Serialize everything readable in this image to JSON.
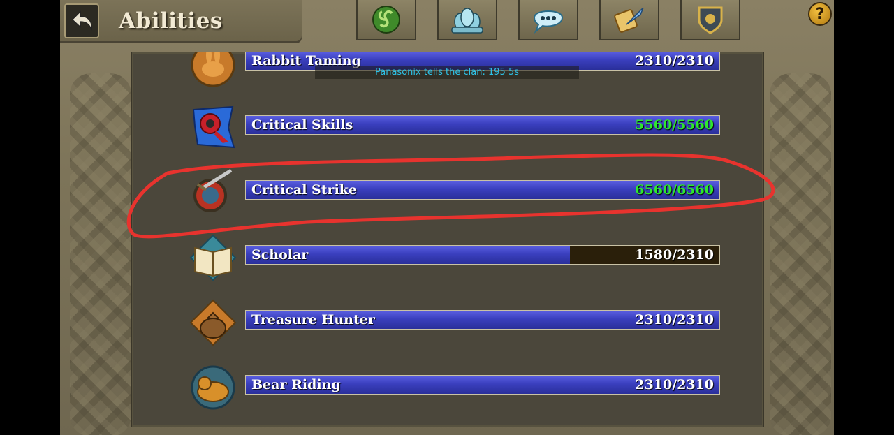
{
  "header": {
    "title": "Abilities"
  },
  "top_buttons": [
    {
      "name": "skills-tab-button",
      "icon": "triskelion-icon"
    },
    {
      "name": "clan-tab-button",
      "icon": "group-icon"
    },
    {
      "name": "chat-tab-button",
      "icon": "speech-bubble-icon"
    },
    {
      "name": "quests-tab-button",
      "icon": "scroll-quill-icon"
    },
    {
      "name": "guild-tab-button",
      "icon": "shield-crest-icon"
    }
  ],
  "help": {
    "label": "?"
  },
  "chat_notice": "Panasonix tells the clan: 195 5s",
  "skills": [
    {
      "name": "Rabbit Taming",
      "value": "2310/2310",
      "progress": 1.0,
      "maxed_green": false,
      "icon": "rabbit-taming-icon"
    },
    {
      "name": "Critical Skills",
      "value": "5560/5560",
      "progress": 1.0,
      "maxed_green": true,
      "icon": "critical-skills-icon"
    },
    {
      "name": "Critical Strike",
      "value": "6560/6560",
      "progress": 1.0,
      "maxed_green": true,
      "icon": "critical-strike-icon"
    },
    {
      "name": "Scholar",
      "value": "1580/2310",
      "progress": 0.684,
      "maxed_green": false,
      "icon": "scholar-book-icon"
    },
    {
      "name": "Treasure Hunter",
      "value": "2310/2310",
      "progress": 1.0,
      "maxed_green": false,
      "icon": "treasure-bag-icon"
    },
    {
      "name": "Bear Riding",
      "value": "2310/2310",
      "progress": 1.0,
      "maxed_green": false,
      "icon": "bear-riding-icon"
    }
  ],
  "colors": {
    "bar_fill": "#3a3fbe",
    "maxed_text": "#2ee82e",
    "highlight": "#e8332e",
    "chat_text": "#2ec3e8"
  }
}
